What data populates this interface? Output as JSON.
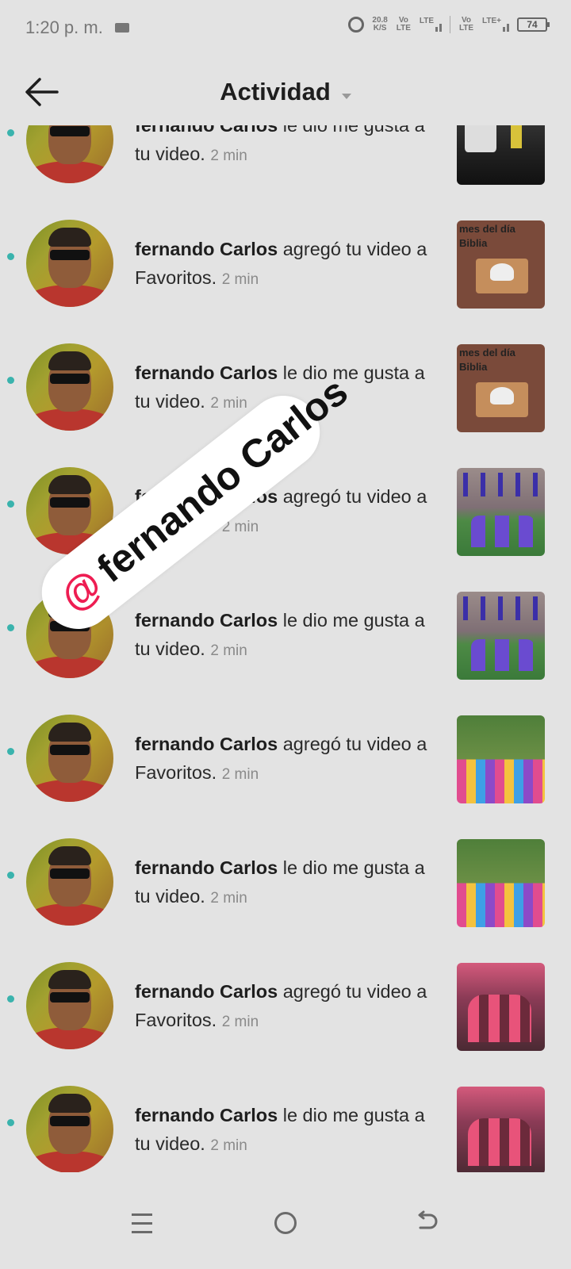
{
  "status_bar": {
    "time": "1:20 p. m.",
    "net_speed": "20.8",
    "net_speed_unit": "K/S",
    "sim1_volte": "Vo LTE",
    "sim1_net": "LTE",
    "sim2_volte": "Vo LTE",
    "sim2_net": "LTE+",
    "battery": "74"
  },
  "header": {
    "title": "Actividad"
  },
  "activities": [
    {
      "name": "fernando Carlos",
      "action": " le dio me gusta a tu video.",
      "time": "2 min",
      "thumb": "dark"
    },
    {
      "name": "fernando Carlos",
      "action": " agregó tu video a Favoritos.",
      "time": "2 min",
      "thumb": "biblia"
    },
    {
      "name": "fernando Carlos",
      "action": " le dio me gusta a tu video.",
      "time": "2 min",
      "thumb": "biblia"
    },
    {
      "name": "fernando Carlos",
      "action": " agregó tu video a Favoritos.",
      "time": "2 min",
      "thumb": "people"
    },
    {
      "name": "fernando Carlos",
      "action": " le dio me gusta a tu video.",
      "time": "2 min",
      "thumb": "people"
    },
    {
      "name": "fernando Carlos",
      "action": " agregó tu video a Favoritos.",
      "time": "2 min",
      "thumb": "stripes"
    },
    {
      "name": "fernando Carlos",
      "action": " le dio me gusta a tu video.",
      "time": "2 min",
      "thumb": "stripes"
    },
    {
      "name": "fernando Carlos",
      "action": " agregó tu video a Favoritos.",
      "time": "2 min",
      "thumb": "group"
    },
    {
      "name": "fernando Carlos",
      "action": " le dio me gusta a tu video.",
      "time": "2 min",
      "thumb": "group"
    }
  ],
  "thumb_text": {
    "biblia_line1": "mes del día",
    "biblia_line2": "Biblia"
  },
  "sticker": {
    "at": "@",
    "name": "fernando Carlos"
  },
  "colors": {
    "accent_dot": "#3ab3ad",
    "sticker_at": "#ee1d52",
    "background": "#e3e3e3"
  },
  "icons": {
    "back": "arrow-left-icon",
    "nav_menu": "menu-icon",
    "nav_home": "home-circle-icon",
    "nav_back": "return-icon"
  }
}
